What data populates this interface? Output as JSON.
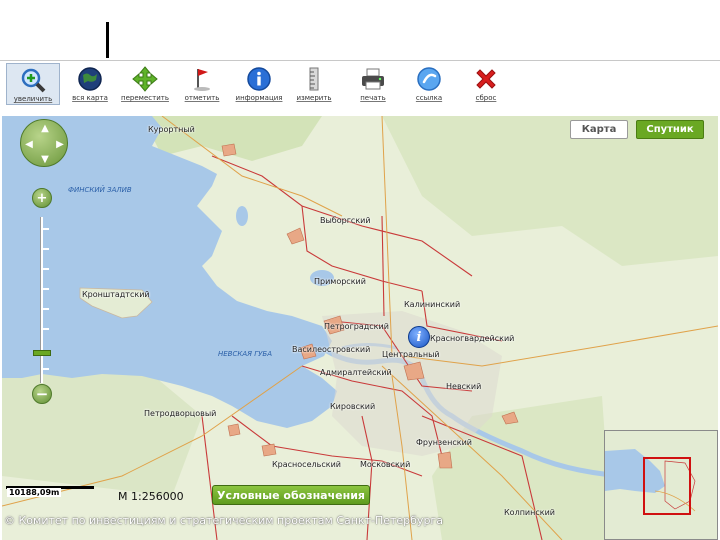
{
  "toolbar": {
    "tools": [
      {
        "label": "увеличить",
        "icon": "zoom-in-icon"
      },
      {
        "label": "вся карта",
        "icon": "globe-icon"
      },
      {
        "label": "переместить",
        "icon": "move-icon"
      },
      {
        "label": "отметить",
        "icon": "flag-icon"
      },
      {
        "label": "информация",
        "icon": "info-icon"
      },
      {
        "label": "измерить",
        "icon": "ruler-icon"
      },
      {
        "label": "печать",
        "icon": "printer-icon"
      },
      {
        "label": "ссылка",
        "icon": "link-icon"
      },
      {
        "label": "сброс",
        "icon": "reset-icon"
      }
    ]
  },
  "map": {
    "type_buttons": {
      "map": "Карта",
      "satellite": "Спутник"
    },
    "district_labels": {
      "kurortny": "Курортный",
      "vyborgsky": "Выборгский",
      "primorsky": "Приморский",
      "kalininsky": "Калининский",
      "kronshtadtsky": "Кронштадтский",
      "petrogradsky": "Петроградский",
      "krasnogvardeysky": "Красногвардейский",
      "vasileostrovsky": "Василеостровский",
      "centralny": "Центральный",
      "admiralteysky": "Адмиралтейский",
      "nevsky": "Невский",
      "kirovsky": "Кировский",
      "petrodvortsovy": "Петродворцовый",
      "frunzensky": "Фрунзенский",
      "krasnoselsky": "Красносельский",
      "moskovsky": "Московский",
      "kolpinsky": "Колпинский"
    },
    "water_labels": {
      "gulf": "ФИНСКИЙ ЗАЛИВ",
      "bay": "НЕВСКАЯ ГУБА"
    },
    "scale_text": "10188,09m",
    "ratio_text": "М 1:256000",
    "legend_button": "Условные обозначения",
    "copyright": "© Комитет по инвестициям и стратегическим проектам Санкт-Петербурга"
  },
  "colors": {
    "water": "#a8c8e8",
    "land": "#e9efd9",
    "accent_green": "#6aa823",
    "district_border": "#c93a3a",
    "info_blue": "#1a56c4"
  }
}
